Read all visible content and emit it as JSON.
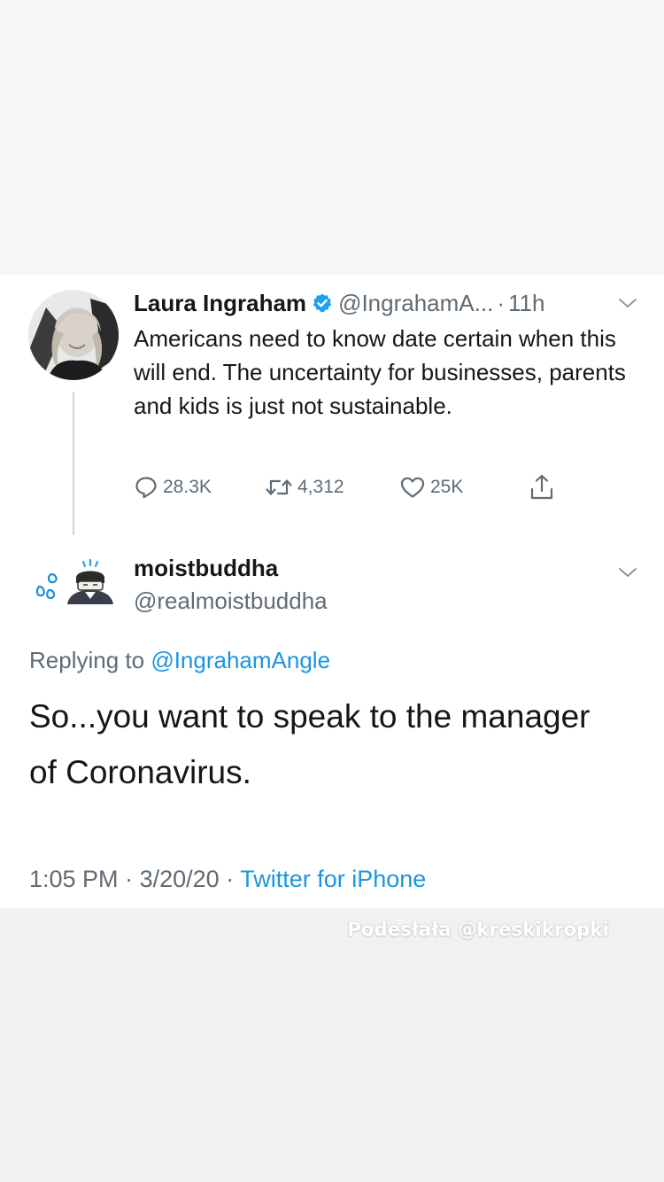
{
  "parent_tweet": {
    "author_name": "Laura Ingraham",
    "handle": "@IngrahamA...",
    "separator": "·",
    "time_ago": "11h",
    "text": "Americans need to know date certain when this will end.  The uncertainty for businesses, parents and kids is just not sustainable.",
    "actions": {
      "replies": "28.3K",
      "retweets": "4,312",
      "likes": "25K"
    },
    "icons": [
      "verified-badge-icon",
      "chevron-down-icon",
      "reply-icon",
      "retweet-icon",
      "heart-icon",
      "share-icon"
    ]
  },
  "reply_tweet": {
    "author_name": "moistbuddha",
    "handle": "@realmoistbuddha",
    "replying_prefix": "Replying to",
    "replying_to": "@IngrahamAngle",
    "text": "So...you want to speak to the manager of Coronavirus.",
    "time": "1:05 PM",
    "date": "3/20/20",
    "separator": "·",
    "source": "Twitter for iPhone",
    "icons": [
      "sweat-droplets-emoji-icon",
      "person-bowing-emoji-icon",
      "chevron-down-icon"
    ]
  },
  "watermark": "Podesłała @kreskikropki",
  "colors": {
    "text": "#14171a",
    "secondary": "#5f6b75",
    "link": "#1b95e0",
    "verified": "#1da1f2",
    "card_bg": "#ffffff",
    "page_bg": "#f6f6f6",
    "bottom_bg": "#eff1f2"
  }
}
